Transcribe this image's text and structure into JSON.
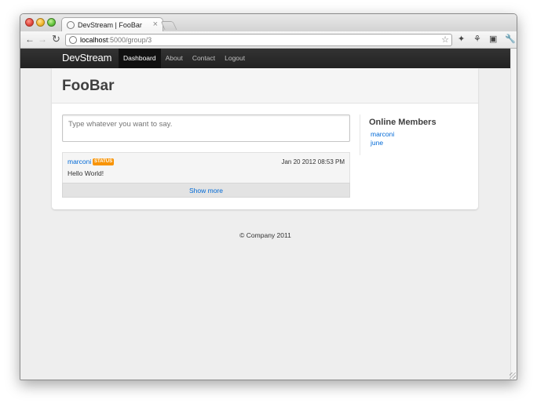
{
  "browser": {
    "tab_title": "DevStream | FooBar",
    "tab_close": "×",
    "url_host": "localhost",
    "url_path": ":5000/group/3",
    "icons": {
      "back": "arrow-left-icon",
      "forward": "arrow-right-icon",
      "reload": "reload-icon",
      "star": "star-icon",
      "extensions": [
        "extension-icon",
        "extension-icon",
        "extension-icon",
        "wrench-icon"
      ]
    }
  },
  "navbar": {
    "brand": "DevStream",
    "items": [
      {
        "label": "Dashboard",
        "active": true
      },
      {
        "label": "About",
        "active": false
      },
      {
        "label": "Contact",
        "active": false
      },
      {
        "label": "Logout",
        "active": false
      }
    ]
  },
  "page": {
    "title": "FooBar",
    "status_placeholder": "Type whatever you want to say."
  },
  "posts": [
    {
      "author": "marconi",
      "badge": "STATUS",
      "time": "Jan 20 2012 08:53 PM",
      "body": "Hello World!"
    }
  ],
  "show_more": "Show more",
  "sidebar": {
    "title": "Online Members",
    "members": [
      "marconi",
      "june"
    ]
  },
  "footer": "© Company 2011",
  "colors": {
    "link": "#0069d6",
    "badge": "#f89406",
    "navbar": "#222222"
  }
}
